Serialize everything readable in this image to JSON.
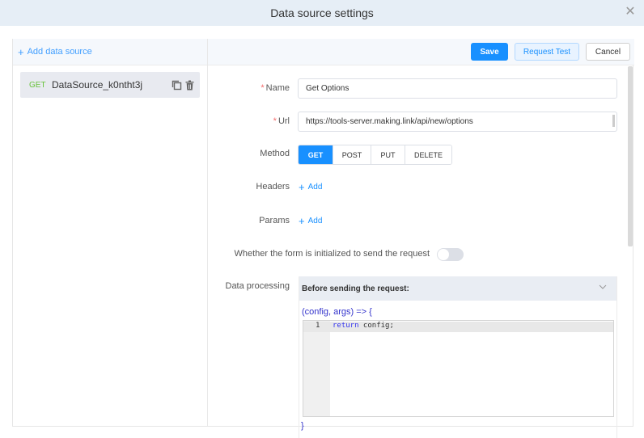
{
  "dialog": {
    "title": "Data source settings",
    "close_icon": "close-icon"
  },
  "sidebar": {
    "add_label": "Add data source",
    "items": [
      {
        "method": "GET",
        "name": "DataSource_k0ntht3j",
        "selected": true
      }
    ]
  },
  "toolbar": {
    "save_label": "Save",
    "test_label": "Request Test",
    "cancel_label": "Cancel"
  },
  "form": {
    "name_label": "Name",
    "name_value": "Get Options",
    "url_label": "Url",
    "url_value": "https://tools-server.making.link/api/new/options",
    "required_mark": "*",
    "method_label": "Method",
    "methods": [
      "GET",
      "POST",
      "PUT",
      "DELETE"
    ],
    "method_selected": "GET",
    "headers_label": "Headers",
    "params_label": "Params",
    "add_label": "Add",
    "init_label": "Whether the form is initialized to send the request",
    "init_enabled": false,
    "processing_label": "Data processing",
    "processing_section": "Before sending the request:",
    "fn_signature": "(config, args) => {",
    "code_lines": [
      {
        "num": "1",
        "keyword": "return",
        "rest": " config;"
      }
    ],
    "fn_end": "}"
  },
  "colors": {
    "primary": "#1890ff",
    "get_method": "#67c23a",
    "required": "#f56c6c"
  }
}
